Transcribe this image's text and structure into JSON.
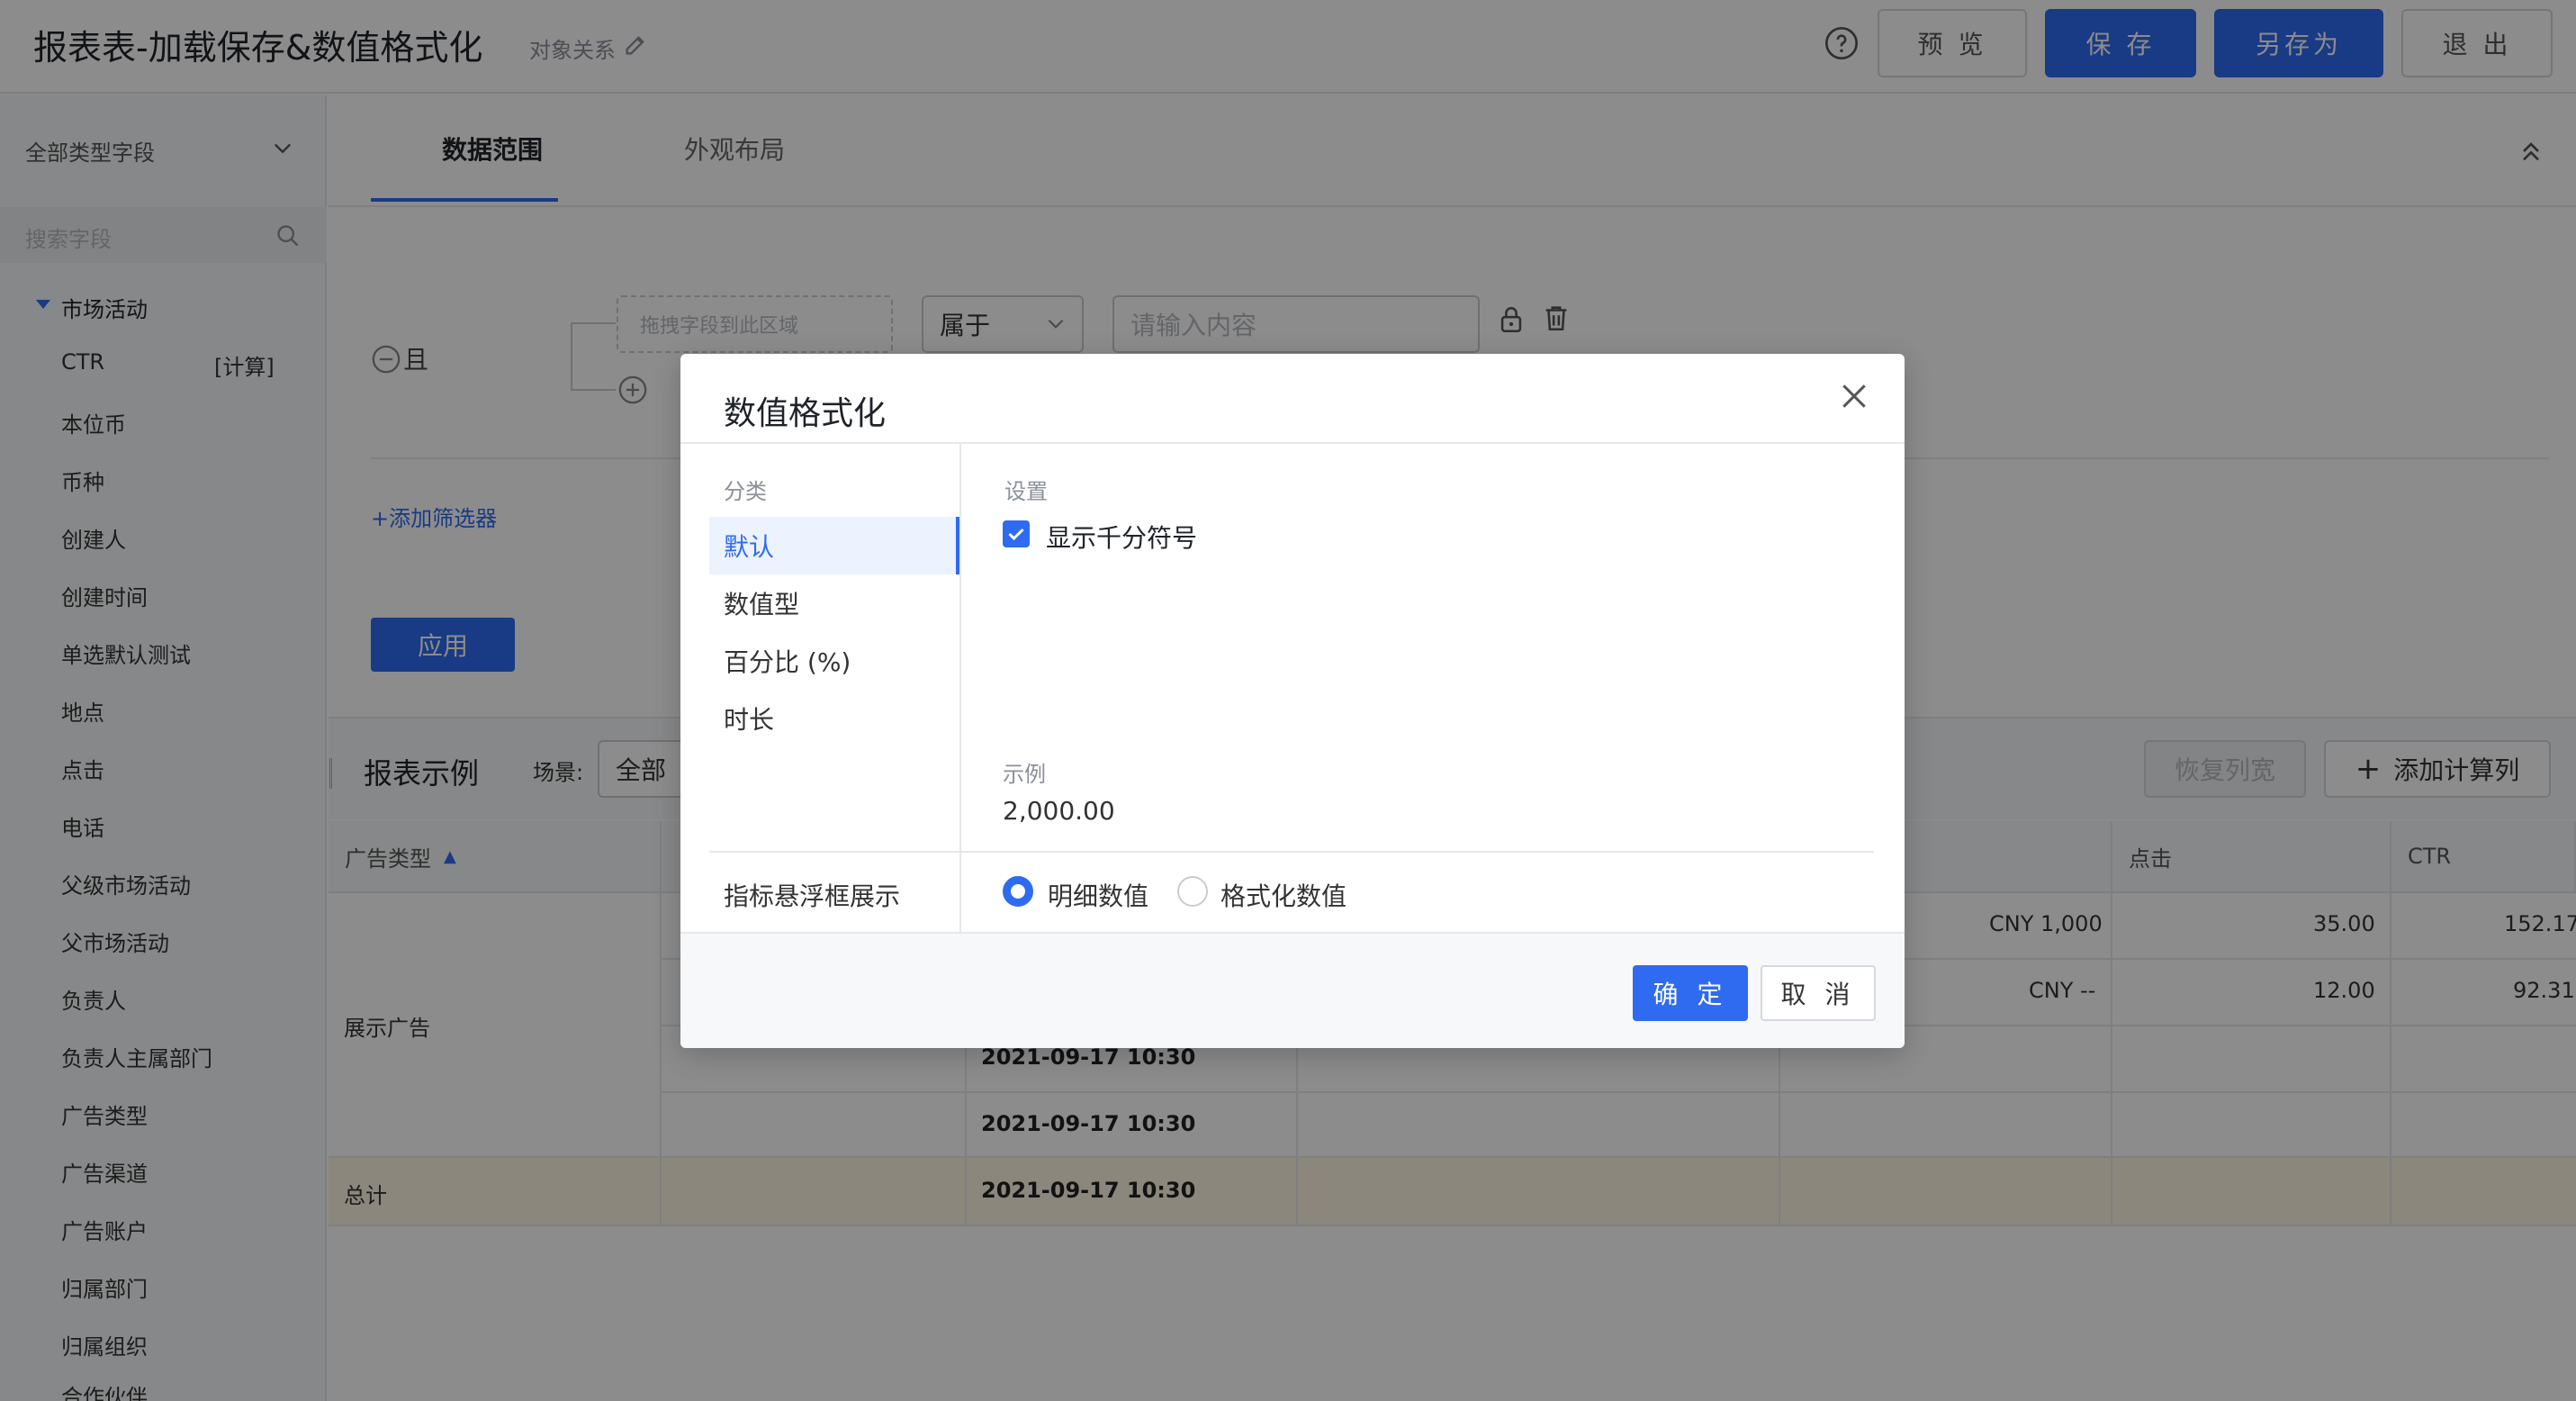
{
  "header": {
    "title": "报表表-加载保存&数值格式化",
    "object_relation": "对象关系",
    "preview": "预 览",
    "save": "保 存",
    "save_as": "另存为",
    "exit": "退 出"
  },
  "sidebar": {
    "field_type": "全部类型字段",
    "search_placeholder": "搜索字段",
    "group": "市场活动",
    "calc_tag": "[计算]",
    "fields": [
      "CTR",
      "本位币",
      "币种",
      "创建人",
      "创建时间",
      "单选默认测试",
      "地点",
      "点击",
      "电话",
      "父级市场活动",
      "父市场活动",
      "负责人",
      "负责人主属部门",
      "广告类型",
      "广告渠道",
      "广告账户",
      "归属部门",
      "归属组织",
      "合作伙伴"
    ]
  },
  "tabs": {
    "data_range": "数据范围",
    "layout": "外观布局"
  },
  "filter": {
    "and_label": "且",
    "drop_zone": "拖拽字段到此区域",
    "operator": "属于",
    "value_placeholder": "请输入内容",
    "add_filter": "+添加筛选器",
    "apply": "应用"
  },
  "report": {
    "title": "报表示例",
    "scene_label": "场景:",
    "scene_value": "全部",
    "restore_columns": "恢复列宽",
    "add_calc_column": "添加计算列",
    "columns": {
      "ad_type": "广告类型",
      "clicks": "点击",
      "ctr": "CTR"
    },
    "rows": {
      "ad_type_value": "展示广告",
      "total_label": "总计",
      "cny_1": "CNY 1,000",
      "clicks_1": "35.00",
      "ctr_1": "152.17",
      "cny_2": "CNY --",
      "clicks_2": "12.00",
      "ctr_2": "92.31",
      "date_3": "2021-09-17 10:30",
      "date_4": "2021-09-17 10:30",
      "date_total": "2021-09-17 10:30"
    }
  },
  "modal": {
    "title": "数值格式化",
    "category_label": "分类",
    "categories": [
      "默认",
      "数值型",
      "百分比 (%)",
      "时长"
    ],
    "selected_category": "默认",
    "settings_label": "设置",
    "show_thousands": "显示千分符号",
    "show_thousands_checked": true,
    "example_label": "示例",
    "example_value": "2,000.00",
    "hover_label": "指标悬浮框展示",
    "hover_options": [
      "明细数值",
      "格式化数值"
    ],
    "hover_selected": "明细数值",
    "ok": "确 定",
    "cancel": "取 消"
  },
  "colors": {
    "primary": "#2f6bf0",
    "overlay": "rgba(0,0,0,0.45)",
    "total_row": "#fdf6e3"
  }
}
